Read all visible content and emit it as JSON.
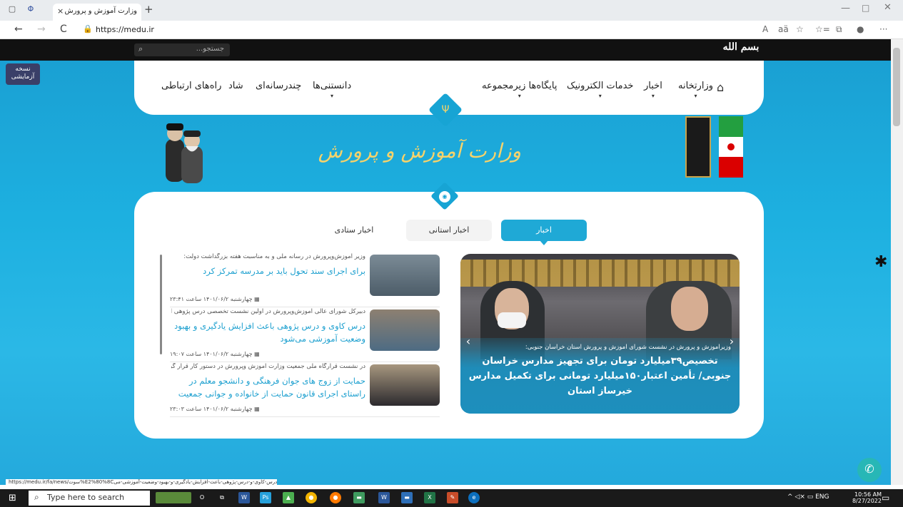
{
  "browser": {
    "tab_title": "وزارت آموزش و پرورش",
    "tab_close": "×",
    "new_tab": "+",
    "url": "https://medu.ir",
    "back": "←",
    "forward": "→",
    "reload": "C",
    "lock": "🔒",
    "minimize": "—",
    "maximize": "□",
    "close": "✕",
    "toolbar_icons": [
      "A",
      "aä",
      "☆",
      "☆=",
      "⧉",
      "●",
      "···"
    ]
  },
  "site": {
    "search_placeholder": "جستجو...",
    "search_icon": "⌕",
    "logo_text": "بسم الله",
    "beta_badge": "نسخه آزمایشی",
    "nav": {
      "home_icon": "⌂",
      "items": [
        {
          "label": "وزارتخانه",
          "caret": "▾"
        },
        {
          "label": "اخبار",
          "caret": "▾"
        },
        {
          "label": "خدمات الکترونیک",
          "caret": "▾"
        },
        {
          "label": "پایگاه‌ها زیرمجموعه",
          "caret": "▾"
        },
        {
          "label": "دانستنی‌ها",
          "caret": "▾"
        },
        {
          "label": "چندرسانه‌ای",
          "caret": ""
        },
        {
          "label": "شاد",
          "caret": ""
        },
        {
          "label": "راه‌های ارتباطی",
          "caret": ""
        }
      ]
    },
    "header_title": "وزارت آموزش و پرورش",
    "rss_icon": "◉",
    "tabs": {
      "news": "اخبار",
      "provincial": "اخبار استانی",
      "staff": "اخبار ستادی"
    },
    "slider": {
      "subtitle": "وزیرآموزش و پرورش در نشست شورای آموزش و پرورش استان خراسان جنوبی:",
      "title": "تخصیص۳۹میلیارد تومان برای تجهیز مدارس خراسان جنوبی/ تأمین اعتبار۱۵۰میلیارد تومانی برای تکمیل مدارس خیرساز استان",
      "prev": "‹",
      "next": "›"
    },
    "news": [
      {
        "lead": "وزیر آموزش‌وپرورش در رسانه ملی و به مناسبت هفته بزرگداشت دولت:",
        "headline": "برای اجرای سند تحول باید بر مدرسه تمرکز کرد",
        "meta": "چهارشنبه ۱۴۰۱/۰۶/۲ ساعت ۲۳:۴۱"
      },
      {
        "lead": "دبیرکل شورای عالی آموزش‌وپرورش در اولین نشست تخصصی درس پژوهی ایران:",
        "headline": "درس کاوی و درس پژوهی باعث افزایش یادگیری و بهبود وضعیت آموزشی می‌شود",
        "meta": "چهارشنبه ۱۴۰۱/۰۶/۲ ساعت ۱۹:۰۷"
      },
      {
        "lead": "در نشست قرارگاه ملی جمعیت وزارت آموزش وپرورش در دستور کار قرار گرفت:",
        "headline": "حمایت از زوج های جوان فرهنگی و دانشجو معلم در راستای اجرای قانون حمایت از خانواده و جوانی جمعیت",
        "meta": "چهارشنبه ۱۴۰۱/۰۶/۲ ساعت ۲۳:۰۳"
      }
    ],
    "calendar_icon": "▦",
    "gear_icon": "✱",
    "chat_icon": "✆",
    "status_url": "https://medu.ir/fa/news/سوت%E2%80%8Cدرس-کاوی-و-درس-پژوهی-باعث-افزایش-یادگیری-و-بهبود-وضعیت-آموزشی-می"
  },
  "taskbar": {
    "start_icon": "⊞",
    "search_placeholder": "Type here to search",
    "search_icon": "⌕",
    "tray": "^ ◁× ▭ ENG",
    "time": "10:56 AM",
    "date": "8/27/2022",
    "notif_icon": "▭"
  },
  "colors": {
    "accent": "#1fa9d6",
    "page_bg": "#1db0e0",
    "headline": "#1b9fcf",
    "gold": "#f6d36b"
  }
}
